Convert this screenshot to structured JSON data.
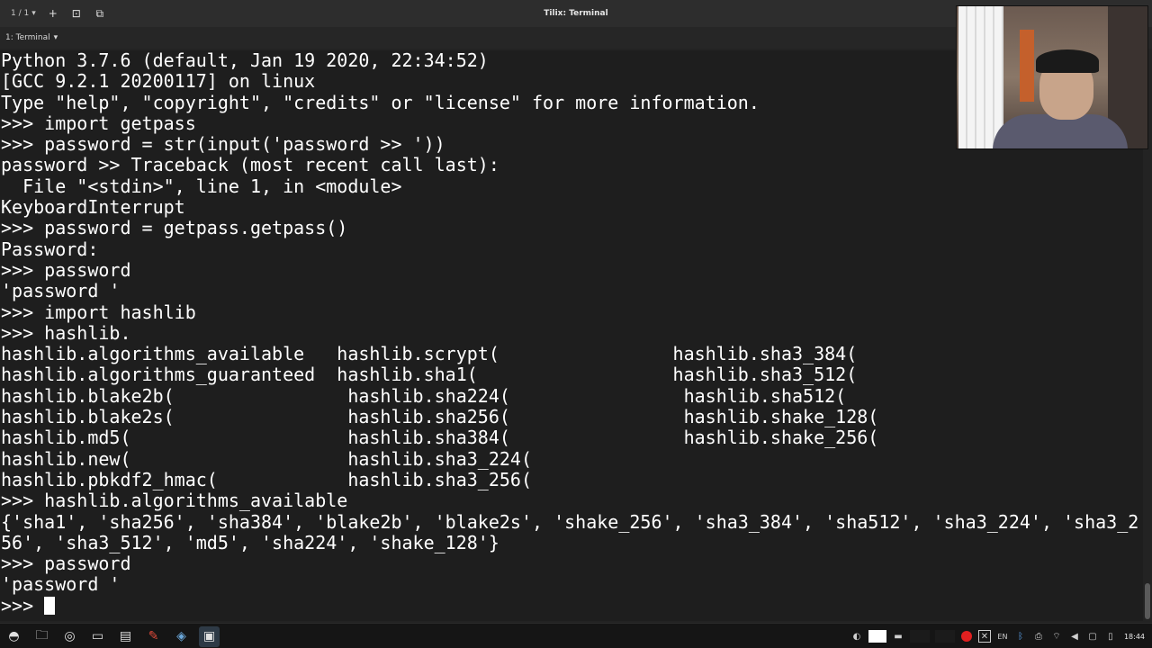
{
  "window": {
    "title": "Tilix: Terminal",
    "session_counter": "1 / 1"
  },
  "tab": {
    "label": "1: Terminal"
  },
  "terminal": {
    "lines": [
      "Python 3.7.6 (default, Jan 19 2020, 22:34:52)",
      "[GCC 9.2.1 20200117] on linux",
      "Type \"help\", \"copyright\", \"credits\" or \"license\" for more information.",
      ">>> import getpass",
      ">>> password = str(input('password >> '))",
      "password >> Traceback (most recent call last):",
      "  File \"<stdin>\", line 1, in <module>",
      "KeyboardInterrupt",
      ">>> password = getpass.getpass()",
      "Password:",
      ">>> password",
      "'password '",
      ">>> import hashlib",
      ">>> hashlib.",
      "hashlib.algorithms_available   hashlib.scrypt(                hashlib.sha3_384(",
      "hashlib.algorithms_guaranteed  hashlib.sha1(                  hashlib.sha3_512(",
      "hashlib.blake2b(                hashlib.sha224(                hashlib.sha512(",
      "hashlib.blake2s(                hashlib.sha256(                hashlib.shake_128(",
      "hashlib.md5(                    hashlib.sha384(                hashlib.shake_256(",
      "hashlib.new(                    hashlib.sha3_224(",
      "hashlib.pbkdf2_hmac(            hashlib.sha3_256(",
      ">>> hashlib.algorithms_available",
      "{'sha1', 'sha256', 'sha384', 'blake2b', 'blake2s', 'shake_256', 'sha3_384', 'sha512', 'sha3_224', 'sha3_2",
      "56', 'sha3_512', 'md5', 'sha224', 'shake_128'}",
      ">>> password",
      "'password '"
    ],
    "prompt": ">>> "
  },
  "taskbar": {
    "tasks": [
      "menu-icon",
      "files-icon",
      "browser-icon",
      "terminal-icon",
      "folder-icon",
      "editor-icon",
      "app-icon",
      "tilix-icon"
    ],
    "tray_language": "EN",
    "clock": "18:44"
  },
  "colors": {
    "terminal_bg": "#1e1e1e",
    "terminal_fg": "#ffffff",
    "titlebar_bg": "#2d2d2d",
    "taskbar_bg": "#151515",
    "record_red": "#e02020"
  }
}
